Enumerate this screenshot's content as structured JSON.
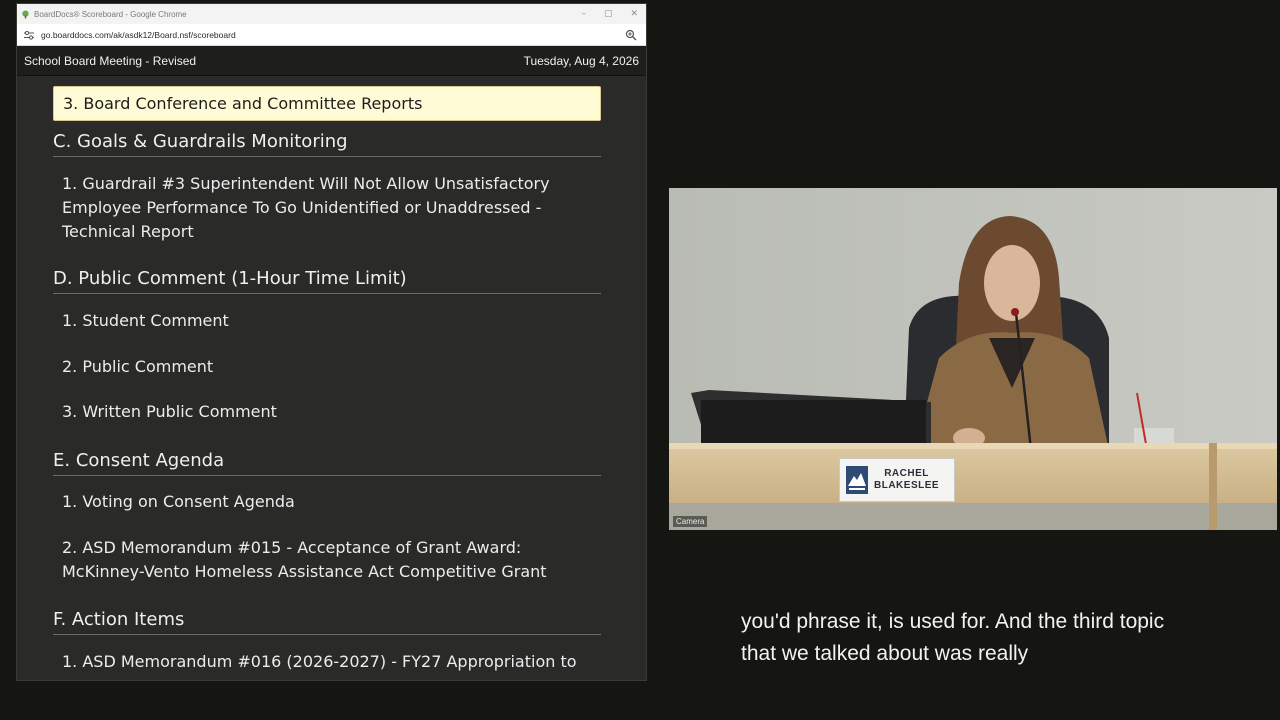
{
  "browser": {
    "window_title": "BoardDocs® Scoreboard - Google Chrome",
    "url": "go.boarddocs.com/ak/asdk12/Board.nsf/scoreboard",
    "controls": {
      "minimize": "–",
      "maximize": "▢",
      "close": "✕"
    }
  },
  "meeting": {
    "title": "School Board Meeting - Revised",
    "date": "Tuesday, Aug 4, 2026"
  },
  "agenda": {
    "current_item": "3. Board Conference and Committee Reports",
    "sections": [
      {
        "heading": "C. Goals & Guardrails Monitoring",
        "items": [
          "1. Guardrail #3 Superintendent Will Not Allow Unsatisfactory Employee Performance To Go Unidentified or Unaddressed - Technical Report"
        ]
      },
      {
        "heading": "D. Public Comment (1-Hour Time Limit)",
        "items": [
          "1. Student Comment",
          "2. Public Comment",
          "3. Written Public Comment"
        ]
      },
      {
        "heading": "E. Consent Agenda",
        "items": [
          "1. Voting on Consent Agenda",
          "2. ASD Memorandum #015 - Acceptance of Grant Award: McKinney-Vento Homeless Assistance Act Competitive Grant"
        ]
      },
      {
        "heading": "F. Action Items",
        "items": [
          "1. ASD Memorandum #016 (2026-2027) - FY27 Appropriation to"
        ]
      }
    ]
  },
  "camera": {
    "label": "Camera",
    "nameplate_line1": "RACHEL",
    "nameplate_line2": "BLAKESLEE"
  },
  "captions": {
    "line1": "you'd phrase it, is used for. And the third topic",
    "line2": "that we talked about was really"
  },
  "colors": {
    "page_background": "#151512",
    "agenda_background": "#2a2a28",
    "highlight": "#fffbd6",
    "caption_text": "#f2f2f2"
  }
}
